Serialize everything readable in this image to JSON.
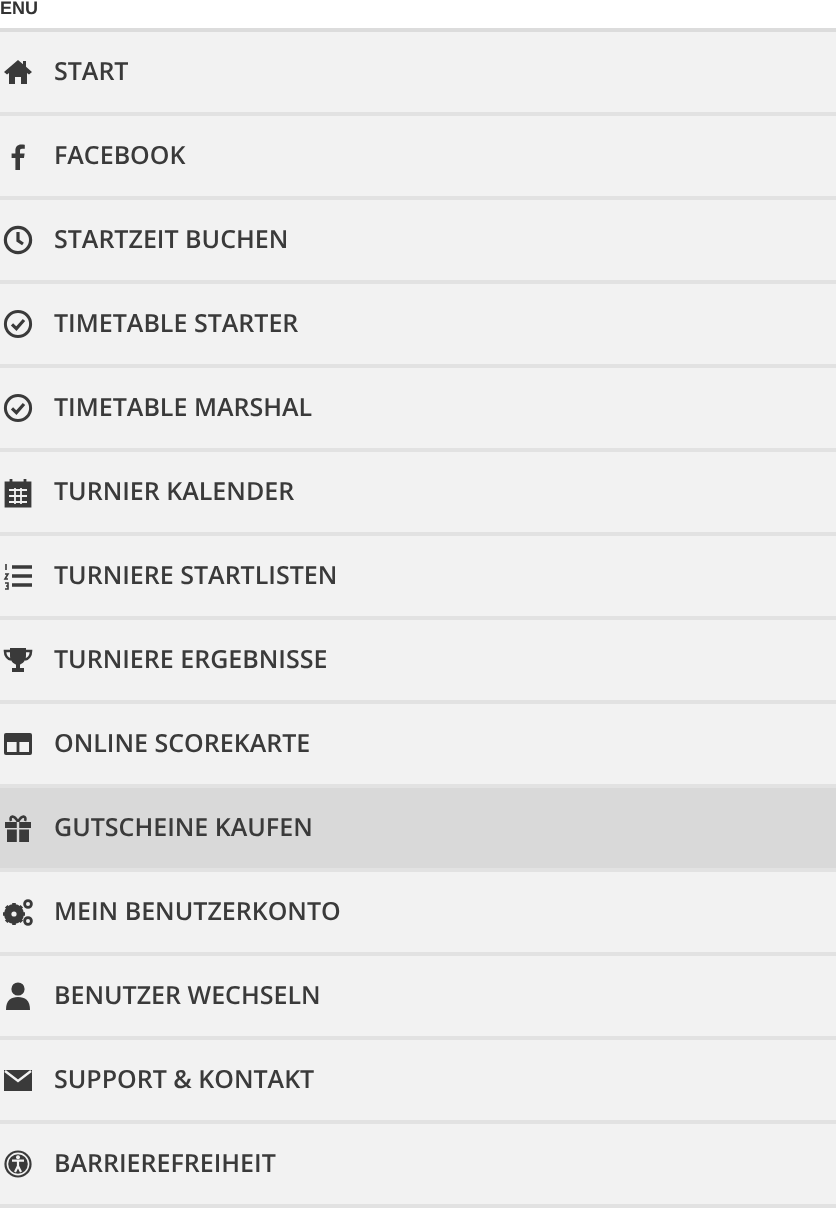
{
  "header": {
    "title": "ENU"
  },
  "menu": [
    {
      "label": "START",
      "selected": false
    },
    {
      "label": "FACEBOOK",
      "selected": false
    },
    {
      "label": "STARTZEIT BUCHEN",
      "selected": false
    },
    {
      "label": "TIMETABLE STARTER",
      "selected": false
    },
    {
      "label": "TIMETABLE MARSHAL",
      "selected": false
    },
    {
      "label": "TURNIER KALENDER",
      "selected": false
    },
    {
      "label": "TURNIERE STARTLISTEN",
      "selected": false
    },
    {
      "label": "TURNIERE ERGEBNISSE",
      "selected": false
    },
    {
      "label": "ONLINE SCOREKARTE",
      "selected": false
    },
    {
      "label": "GUTSCHEINE KAUFEN",
      "selected": true
    },
    {
      "label": "MEIN BENUTZERKONTO",
      "selected": false
    },
    {
      "label": "BENUTZER WECHSELN",
      "selected": false
    },
    {
      "label": "SUPPORT & KONTAKT",
      "selected": false
    },
    {
      "label": "BARRIEREFREIHEIT",
      "selected": false
    }
  ]
}
